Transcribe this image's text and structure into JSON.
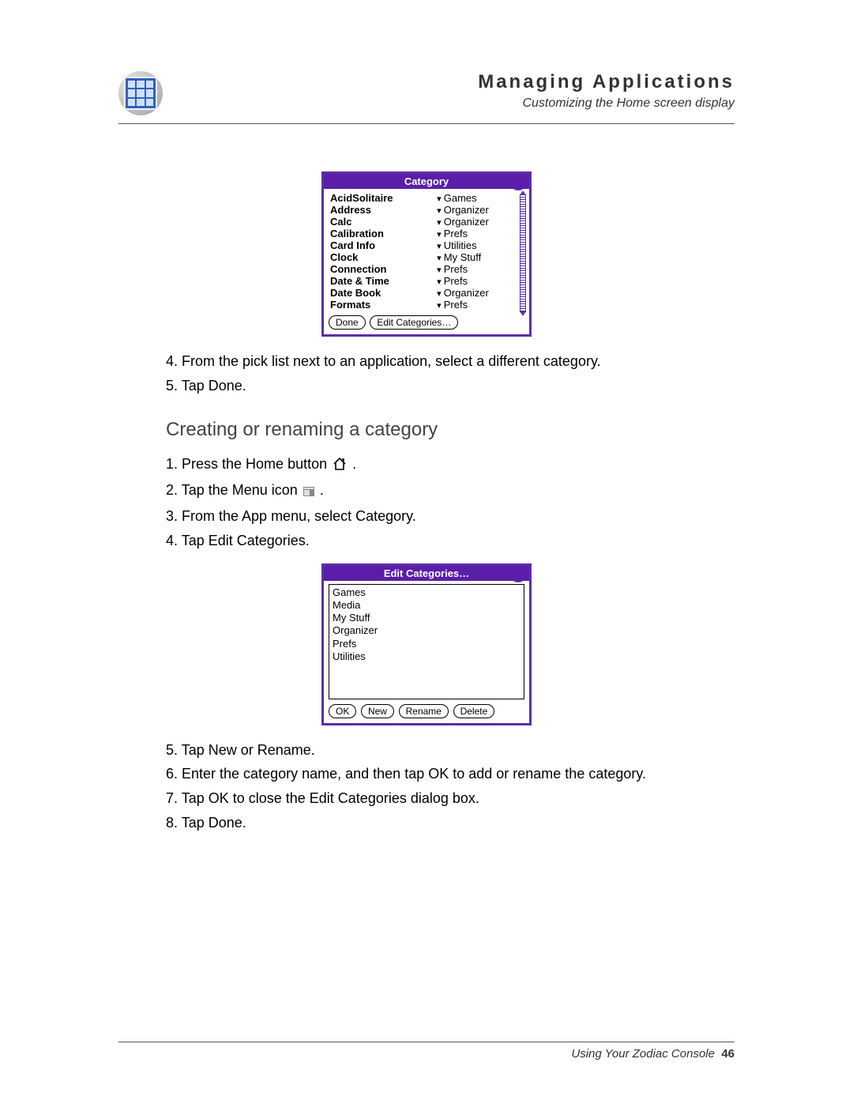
{
  "header": {
    "title": "Managing Applications",
    "subtitle": "Customizing the Home screen display"
  },
  "category_dialog": {
    "title": "Category",
    "rows": [
      {
        "name": "AcidSolitaire",
        "cat": "Games"
      },
      {
        "name": "Address",
        "cat": "Organizer"
      },
      {
        "name": "Calc",
        "cat": "Organizer"
      },
      {
        "name": "Calibration",
        "cat": "Prefs"
      },
      {
        "name": "Card Info",
        "cat": "Utilities"
      },
      {
        "name": "Clock",
        "cat": "My Stuff"
      },
      {
        "name": "Connection",
        "cat": "Prefs"
      },
      {
        "name": "Date & Time",
        "cat": "Prefs"
      },
      {
        "name": "Date Book",
        "cat": "Organizer"
      },
      {
        "name": "Formats",
        "cat": "Prefs"
      }
    ],
    "done": "Done",
    "edit": "Edit Categories…"
  },
  "steps_a": {
    "s4": "4. From the pick list next to an application, select a different category.",
    "s5": "5. Tap Done."
  },
  "section_heading": "Creating or renaming a category",
  "steps_b1": {
    "s1a": "1. Press the Home button ",
    "s1b": ".",
    "s2a": "2. Tap the Menu icon ",
    "s2b": ".",
    "s3": "3. From the App menu, select Category.",
    "s4": "4. Tap Edit Categories."
  },
  "edit_dialog": {
    "title": "Edit Categories…",
    "items": [
      "Games",
      "Media",
      "My Stuff",
      "Organizer",
      "Prefs",
      "Utilities"
    ],
    "ok": "OK",
    "new": "New",
    "rename": "Rename",
    "delete": "Delete"
  },
  "steps_b2": {
    "s5": "5. Tap New or Rename.",
    "s6": "6. Enter the category name, and then tap OK to add or rename the category.",
    "s7": "7. Tap OK to close the Edit Categories dialog box.",
    "s8": "8. Tap Done."
  },
  "footer": {
    "text": "Using Your Zodiac Console",
    "page": "46"
  }
}
